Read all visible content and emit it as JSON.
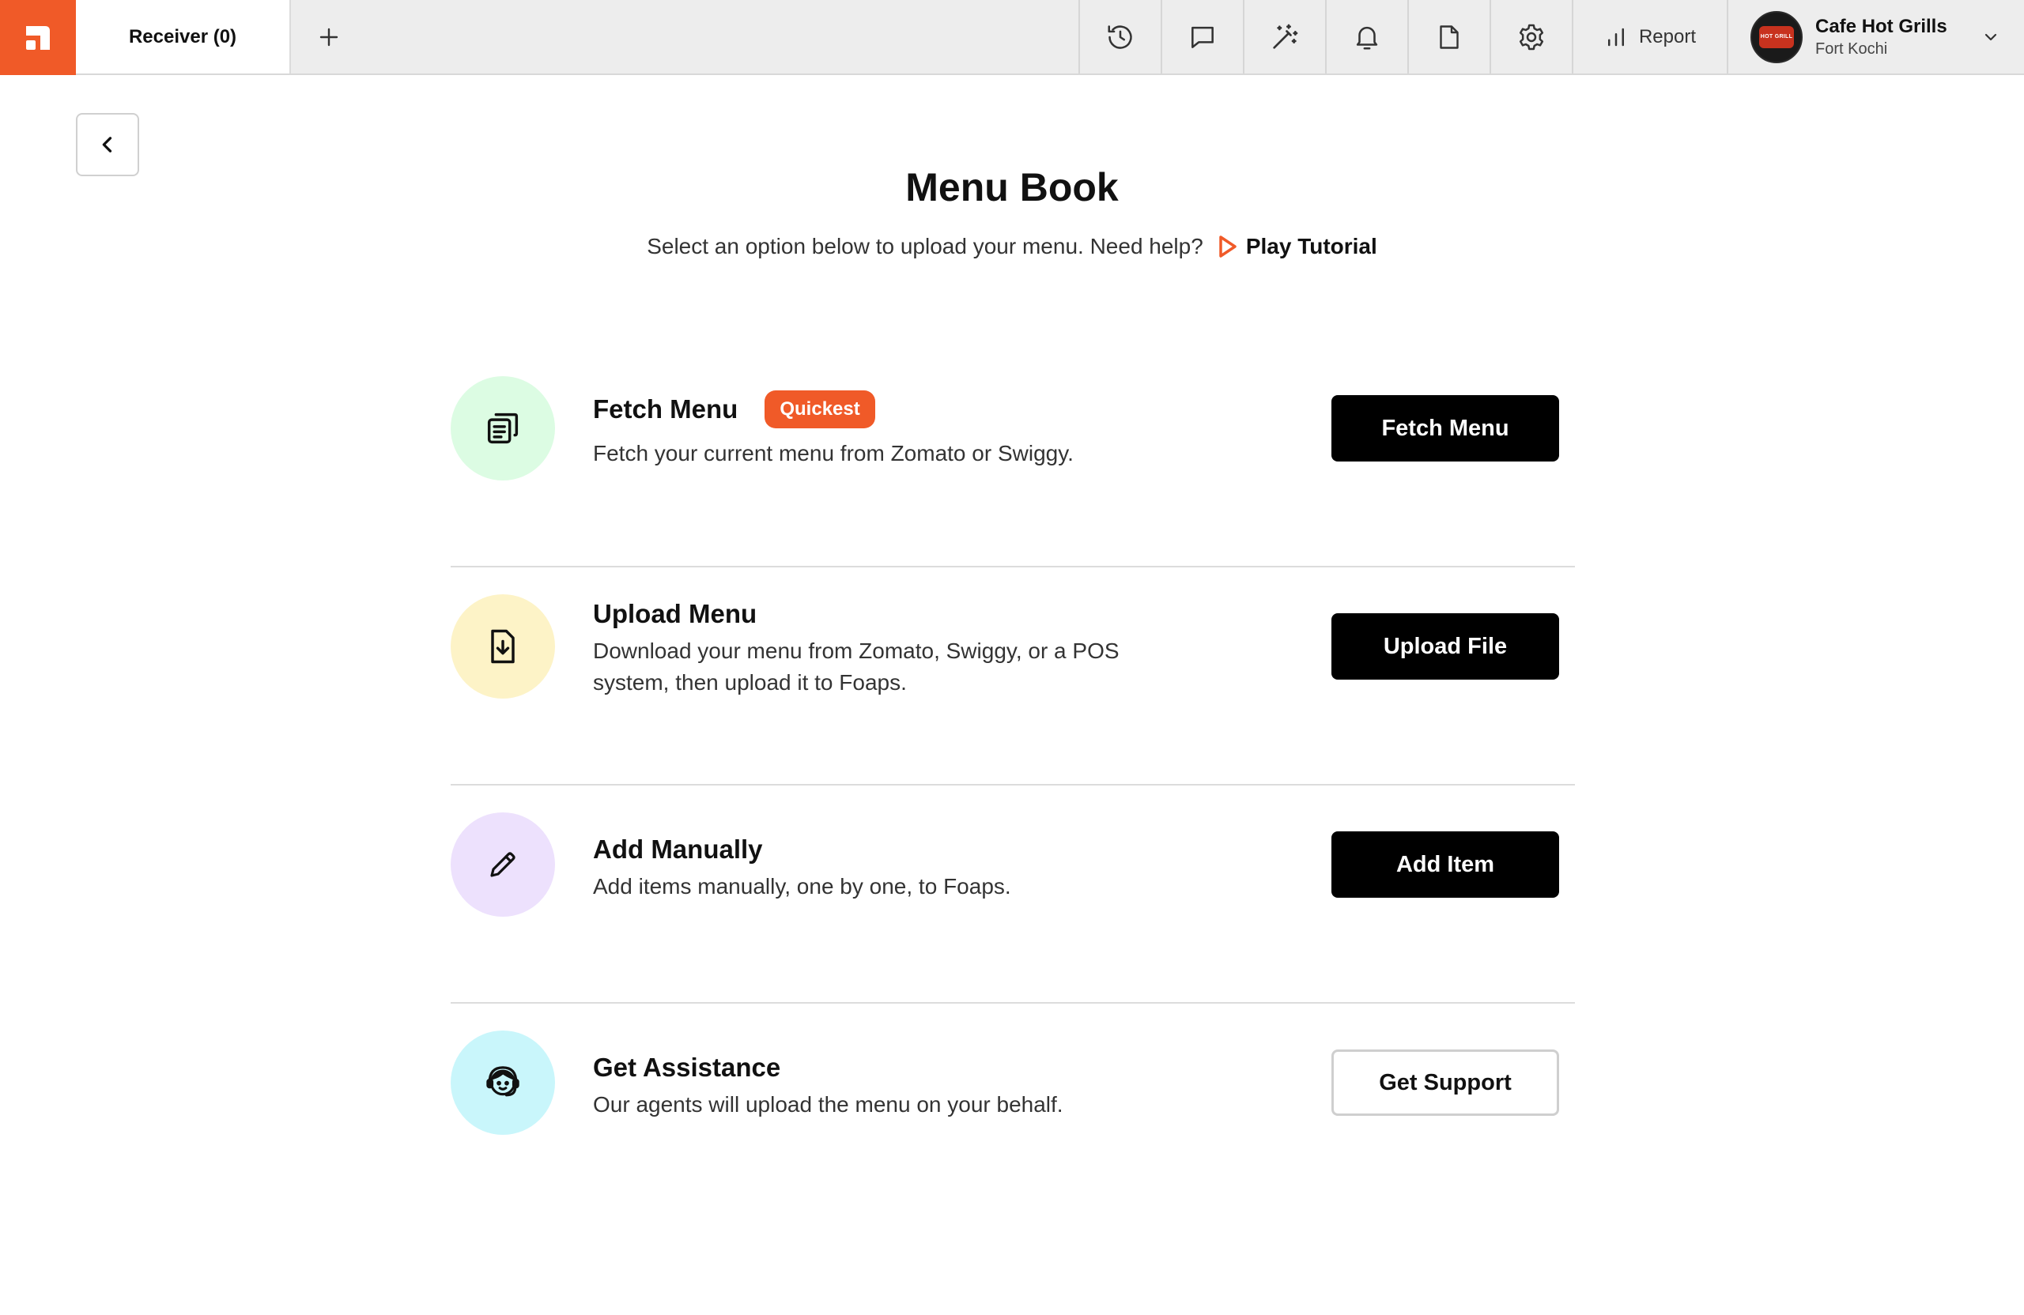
{
  "topbar": {
    "tab_label": "Receiver (0)",
    "report_label": "Report",
    "profile": {
      "name": "Cafe Hot Grills",
      "location": "Fort Kochi",
      "logo_text": "HOT GRILL"
    },
    "tools": [
      "history-icon",
      "chat-icon",
      "magic-wand-icon",
      "bell-icon",
      "document-icon",
      "gear-icon"
    ]
  },
  "header": {
    "title": "Menu Book",
    "subtitle": "Select an option below to upload your menu. Need help?",
    "tutorial_label": "Play Tutorial"
  },
  "options": [
    {
      "title": "Fetch Menu",
      "badge": "Quickest",
      "description": "Fetch your current menu from Zomato or Swiggy.",
      "button": "Fetch Menu",
      "icon": "menu-list-icon",
      "icon_bg": "#dcfce3"
    },
    {
      "title": "Upload Menu",
      "description": "Download your menu from Zomato, Swiggy, or a POS system, then upload it to Foaps.",
      "button": "Upload File",
      "icon": "file-download-icon",
      "icon_bg": "#fdf3c7"
    },
    {
      "title": "Add Manually",
      "description": "Add items manually, one by one, to Foaps.",
      "button": "Add Item",
      "icon": "pencil-icon",
      "icon_bg": "#ede1fd"
    },
    {
      "title": "Get Assistance",
      "description": "Our agents will upload the menu on your behalf.",
      "button": "Get Support",
      "icon": "support-agent-icon",
      "icon_bg": "#c9f6fb"
    }
  ],
  "colors": {
    "accent": "#f05a28",
    "primary_button": "#000000",
    "divider": "#dcdcdc",
    "topbar_bg": "#ededed"
  }
}
